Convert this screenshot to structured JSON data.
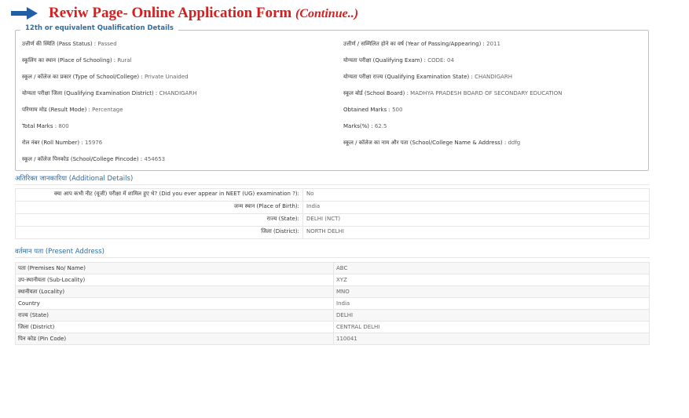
{
  "header": {
    "title": "Reviw Page- Online Application Form",
    "title_suffix": "(Continue..)"
  },
  "qualification": {
    "legend": "12th or equivalent Qualification Details",
    "rows": [
      {
        "left_label": "उत्तीर्ण की स्थिति (Pass Status) :",
        "left_value": "Passed",
        "right_label": "उत्तीर्ण / सम्मिलित होने का वर्ष (Year of Passing/Appearing) :",
        "right_value": "2011"
      },
      {
        "left_label": "स्कूलिंग का स्थान (Place of Schooling) :",
        "left_value": "Rural",
        "right_label": "योग्यता परीक्षा (Qualifying Exam) :",
        "right_value": "CODE: 04"
      },
      {
        "left_label": "स्कूल / कॉलेज का प्रकार (Type of School/College) :",
        "left_value": "Private Unaided",
        "right_label": "योग्यता परीक्षा राज्य (Qualifying Examination State) :",
        "right_value": "CHANDIGARH"
      },
      {
        "left_label": "योग्यता परीक्षा जिला (Qualifying Examination District) :",
        "left_value": "CHANDIGARH",
        "right_label": "स्कूल बोर्ड (School Board) :",
        "right_value": "MADHYA PRADESH BOARD OF SECONDARY EDUCATION"
      },
      {
        "left_label": "परिणाम मोड (Result Mode) :",
        "left_value": "Percentage",
        "right_label": "Obtained Marks :",
        "right_value": "500"
      },
      {
        "left_label": "Total Marks :",
        "left_value": "800",
        "right_label": "Marks(%) :",
        "right_value": "62.5"
      },
      {
        "left_label": "रोल नंबर (Roll Number) :",
        "left_value": "15976",
        "right_label": "स्कूल / कॉलेज का नाम और पता (School/College Name & Address) :",
        "right_value": "ddfg"
      },
      {
        "left_label": "स्कूल / कॉलेज पिनकोड (School/College Pincode) :",
        "left_value": "454653",
        "right_label": "",
        "right_value": ""
      }
    ]
  },
  "additional": {
    "title_hi": "अतिरिक्त जानकारिया",
    "title_en": "(Additional Details)",
    "rows": [
      {
        "label": "क्या आप कभी नीट (यूजी) परीक्षा में शामिल हुए थे? (Did you ever appear in NEET (UG) examination ?):",
        "value": "No"
      },
      {
        "label": "जन्म स्थान (Place of Birth):",
        "value": "India"
      },
      {
        "label": "राज्य (State):",
        "value": "DELHI (NCT)"
      },
      {
        "label": "जिला (District):",
        "value": "NORTH DELHI"
      }
    ]
  },
  "present_address": {
    "title_hi": "वर्तमान पता",
    "title_en": "(Present Address)",
    "rows": [
      {
        "label": "पता (Premises No/ Name)",
        "value": "ABC"
      },
      {
        "label": "उप-स्थानीयता (Sub-Locality)",
        "value": "XYZ"
      },
      {
        "label": "स्थानीयता (Locality)",
        "value": "MNO"
      },
      {
        "label": "Country",
        "value": "India"
      },
      {
        "label": "राज्य (State)",
        "value": "DELHI"
      },
      {
        "label": "जिला (District)",
        "value": "CENTRAL DELHI"
      },
      {
        "label": "पिन कोड (Pin Code)",
        "value": "110041"
      }
    ]
  },
  "colors": {
    "title": "#d91c1c",
    "arrow": "#1f5fa8",
    "section": "#2e6da4"
  }
}
